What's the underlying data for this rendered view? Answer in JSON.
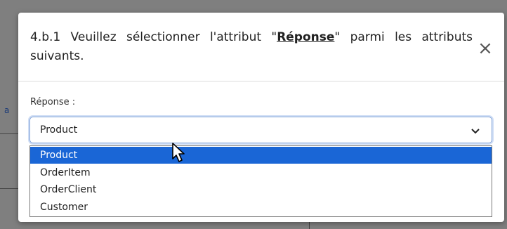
{
  "background": {
    "fragment_left": "a"
  },
  "modal": {
    "title_prefix": "4.b.1 Veuillez sélectionner l'attribut \"",
    "title_keyword": "Réponse",
    "title_suffix": "\" parmi les attributs suivants.",
    "close_icon": "×",
    "field_label": "Réponse :",
    "select": {
      "value": "Product",
      "options": [
        "Product",
        "OrderItem",
        "OrderClient",
        "Customer"
      ],
      "highlighted_index": 0
    }
  },
  "colors": {
    "highlight": "#1a66d6",
    "focus_ring": "#86a6d9"
  }
}
